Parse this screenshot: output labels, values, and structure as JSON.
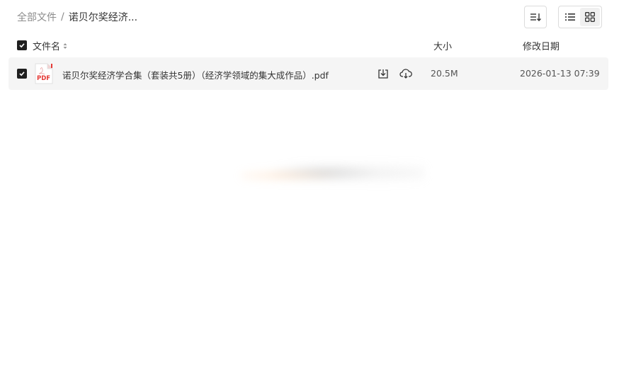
{
  "breadcrumb": {
    "root": "全部文件",
    "separator": "/",
    "current": "诺贝尔奖经济..."
  },
  "toolbar": {
    "sort_icon": "sort-icon",
    "list_view_icon": "list-view-icon",
    "grid_view_icon": "grid-view-icon"
  },
  "table": {
    "headers": {
      "name": "文件名",
      "size": "大小",
      "date": "修改日期"
    },
    "rows": [
      {
        "name": "诺贝尔奖经济学合集（套装共5册）（经济学领域的集大成作品）.pdf",
        "type": "PDF",
        "size": "20.5M",
        "date": "2026-01-13 07:39",
        "selected": true
      }
    ]
  },
  "colors": {
    "pdf_red": "#e53935",
    "checkbox": "#1f1f1f",
    "row_bg": "#f5f5f5"
  }
}
